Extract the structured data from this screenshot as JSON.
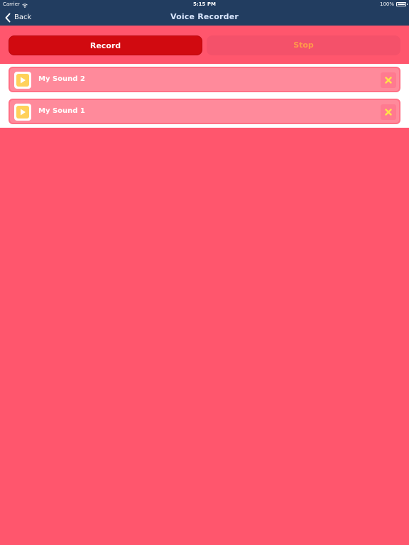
{
  "status_bar": {
    "carrier": "Carrier",
    "time": "5:15 PM",
    "battery": "100%"
  },
  "nav": {
    "back_label": "Back",
    "title": "Voice Recorder"
  },
  "controls": {
    "record_label": "Record",
    "stop_label": "Stop"
  },
  "recordings": [
    {
      "name": "My Sound 2"
    },
    {
      "name": "My Sound 1"
    }
  ],
  "colors": {
    "nav_bg": "#223d60",
    "background": "#ff566d",
    "record_bg": "#d10a10",
    "stop_text": "#ff9a4a",
    "row_bg": "#ff8a9b",
    "play_accent": "#ffd15a"
  }
}
